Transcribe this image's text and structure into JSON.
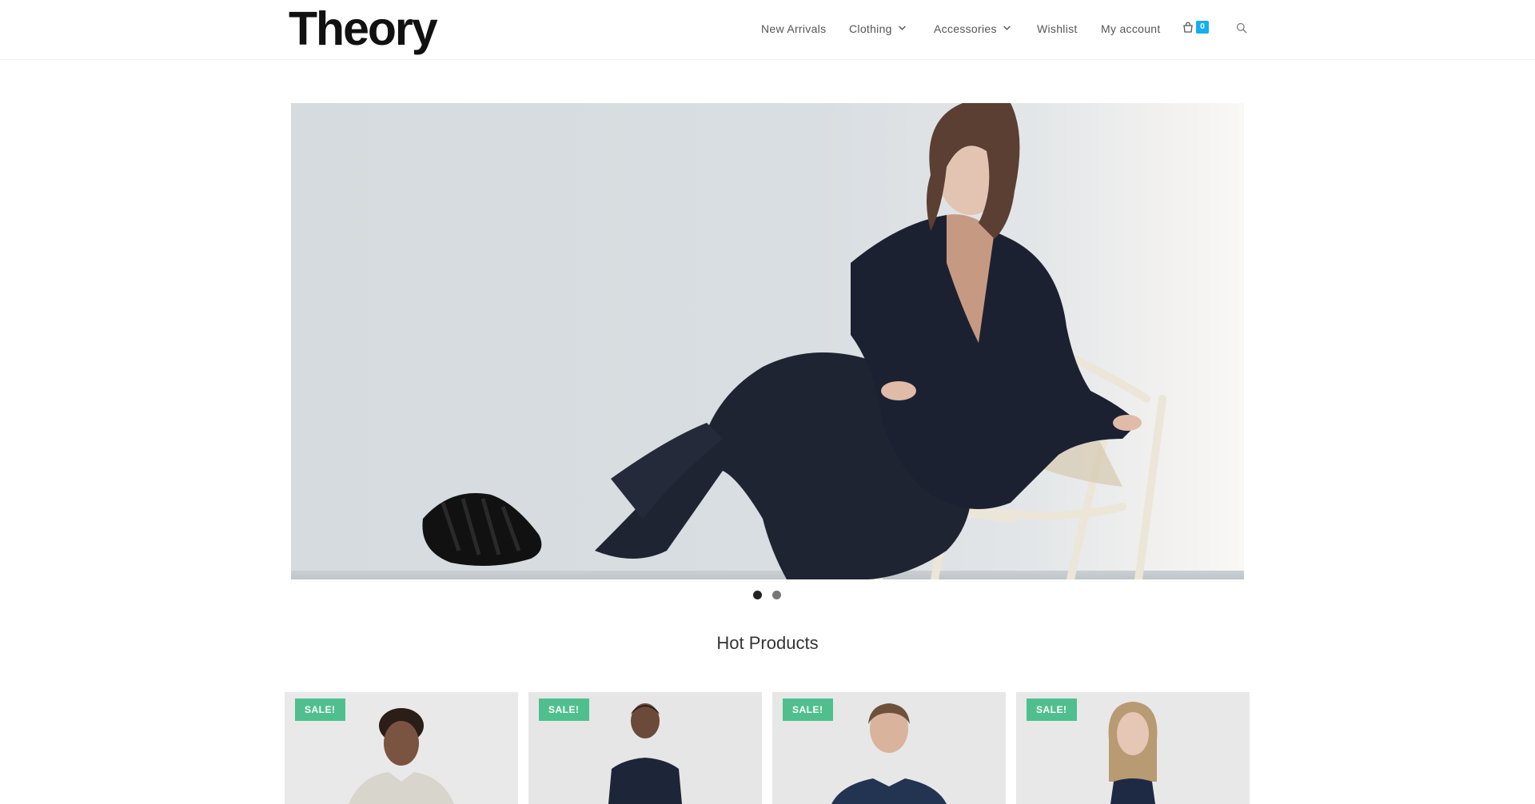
{
  "brand": {
    "logo_text": "Theory"
  },
  "nav": {
    "items": [
      {
        "label": "New Arrivals",
        "has_dropdown": false
      },
      {
        "label": "Clothing",
        "has_dropdown": true
      },
      {
        "label": "Accessories",
        "has_dropdown": true
      },
      {
        "label": "Wishlist",
        "has_dropdown": false
      },
      {
        "label": "My account",
        "has_dropdown": false
      }
    ],
    "cart_count": "0",
    "cart_icon": "shopping-bag-icon",
    "search_icon": "search-icon"
  },
  "hero": {
    "slides": 2,
    "active_slide": 1,
    "image": "woman-in-navy-suit-seated-on-chair"
  },
  "sections": {
    "hot_products_title": "Hot Products"
  },
  "products": [
    {
      "badge": "SALE!",
      "image": "man-in-light-shirt"
    },
    {
      "badge": "SALE!",
      "image": "man-in-navy-tshirt"
    },
    {
      "badge": "SALE!",
      "image": "man-in-navy-shirt"
    },
    {
      "badge": "SALE!",
      "image": "woman-in-navy-top"
    }
  ],
  "colors": {
    "accent": "#13aff0",
    "sale_badge": "#4fc08d",
    "text": "#555555"
  }
}
